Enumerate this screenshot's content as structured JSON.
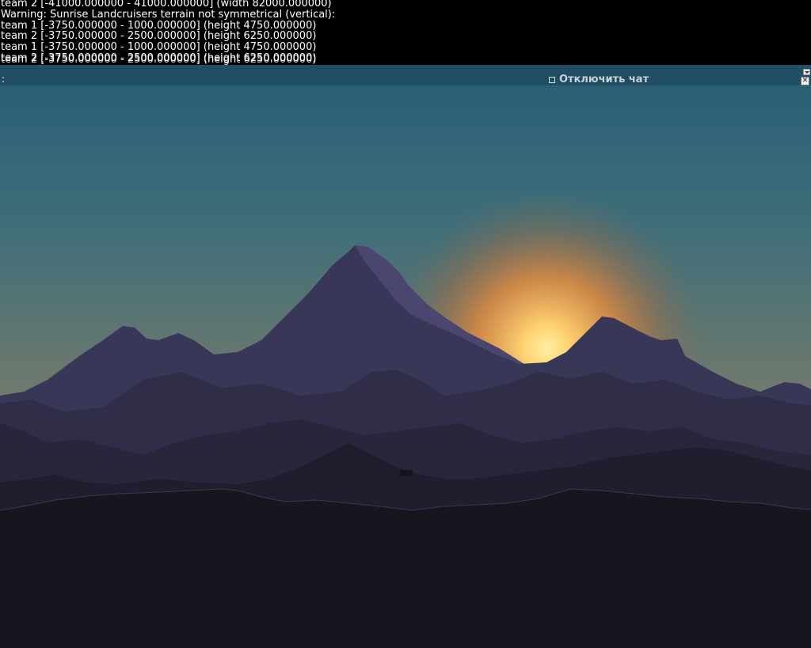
{
  "console": {
    "lines": [
      "team 2 [-41000.000000 - 41000.000000] (width 82000.000000)",
      "Warning: Sunrise Landcruisers terrain not symmetrical (vertical):",
      "team 1 [-3750.000000 - 1000.000000] (height 4750.000000)",
      "team 2 [-3750.000000 - 2500.000000] (height 6250.000000)",
      "team 1 [-3750.000000 - 1000.000000] (height 4750.000000)",
      "team 2 [-3750.000000 - 2500.000000] (height 6250.000000)"
    ],
    "overflow_line": "team 2 [-3750.000000 - 2500.000000] (height 6250.000000)"
  },
  "chat": {
    "prompt": ":",
    "disable_chat_label": "Отключить чат",
    "disable_chat_checked": false,
    "close_icon": "close-icon",
    "scroll_icon": "chevron-down-icon"
  },
  "scene": {
    "sky_top": "#1f5a75",
    "sky_mid": "#4d7177",
    "sky_low": "#b28650",
    "sun_color": "#ffe27a",
    "far_range": "#3a3858",
    "peak_highlight": "#4a4670",
    "mid_range": "#2f2d47",
    "near_range": "#25243a",
    "foreground_hill": "#1d1c2b",
    "ground": "#17161f"
  }
}
